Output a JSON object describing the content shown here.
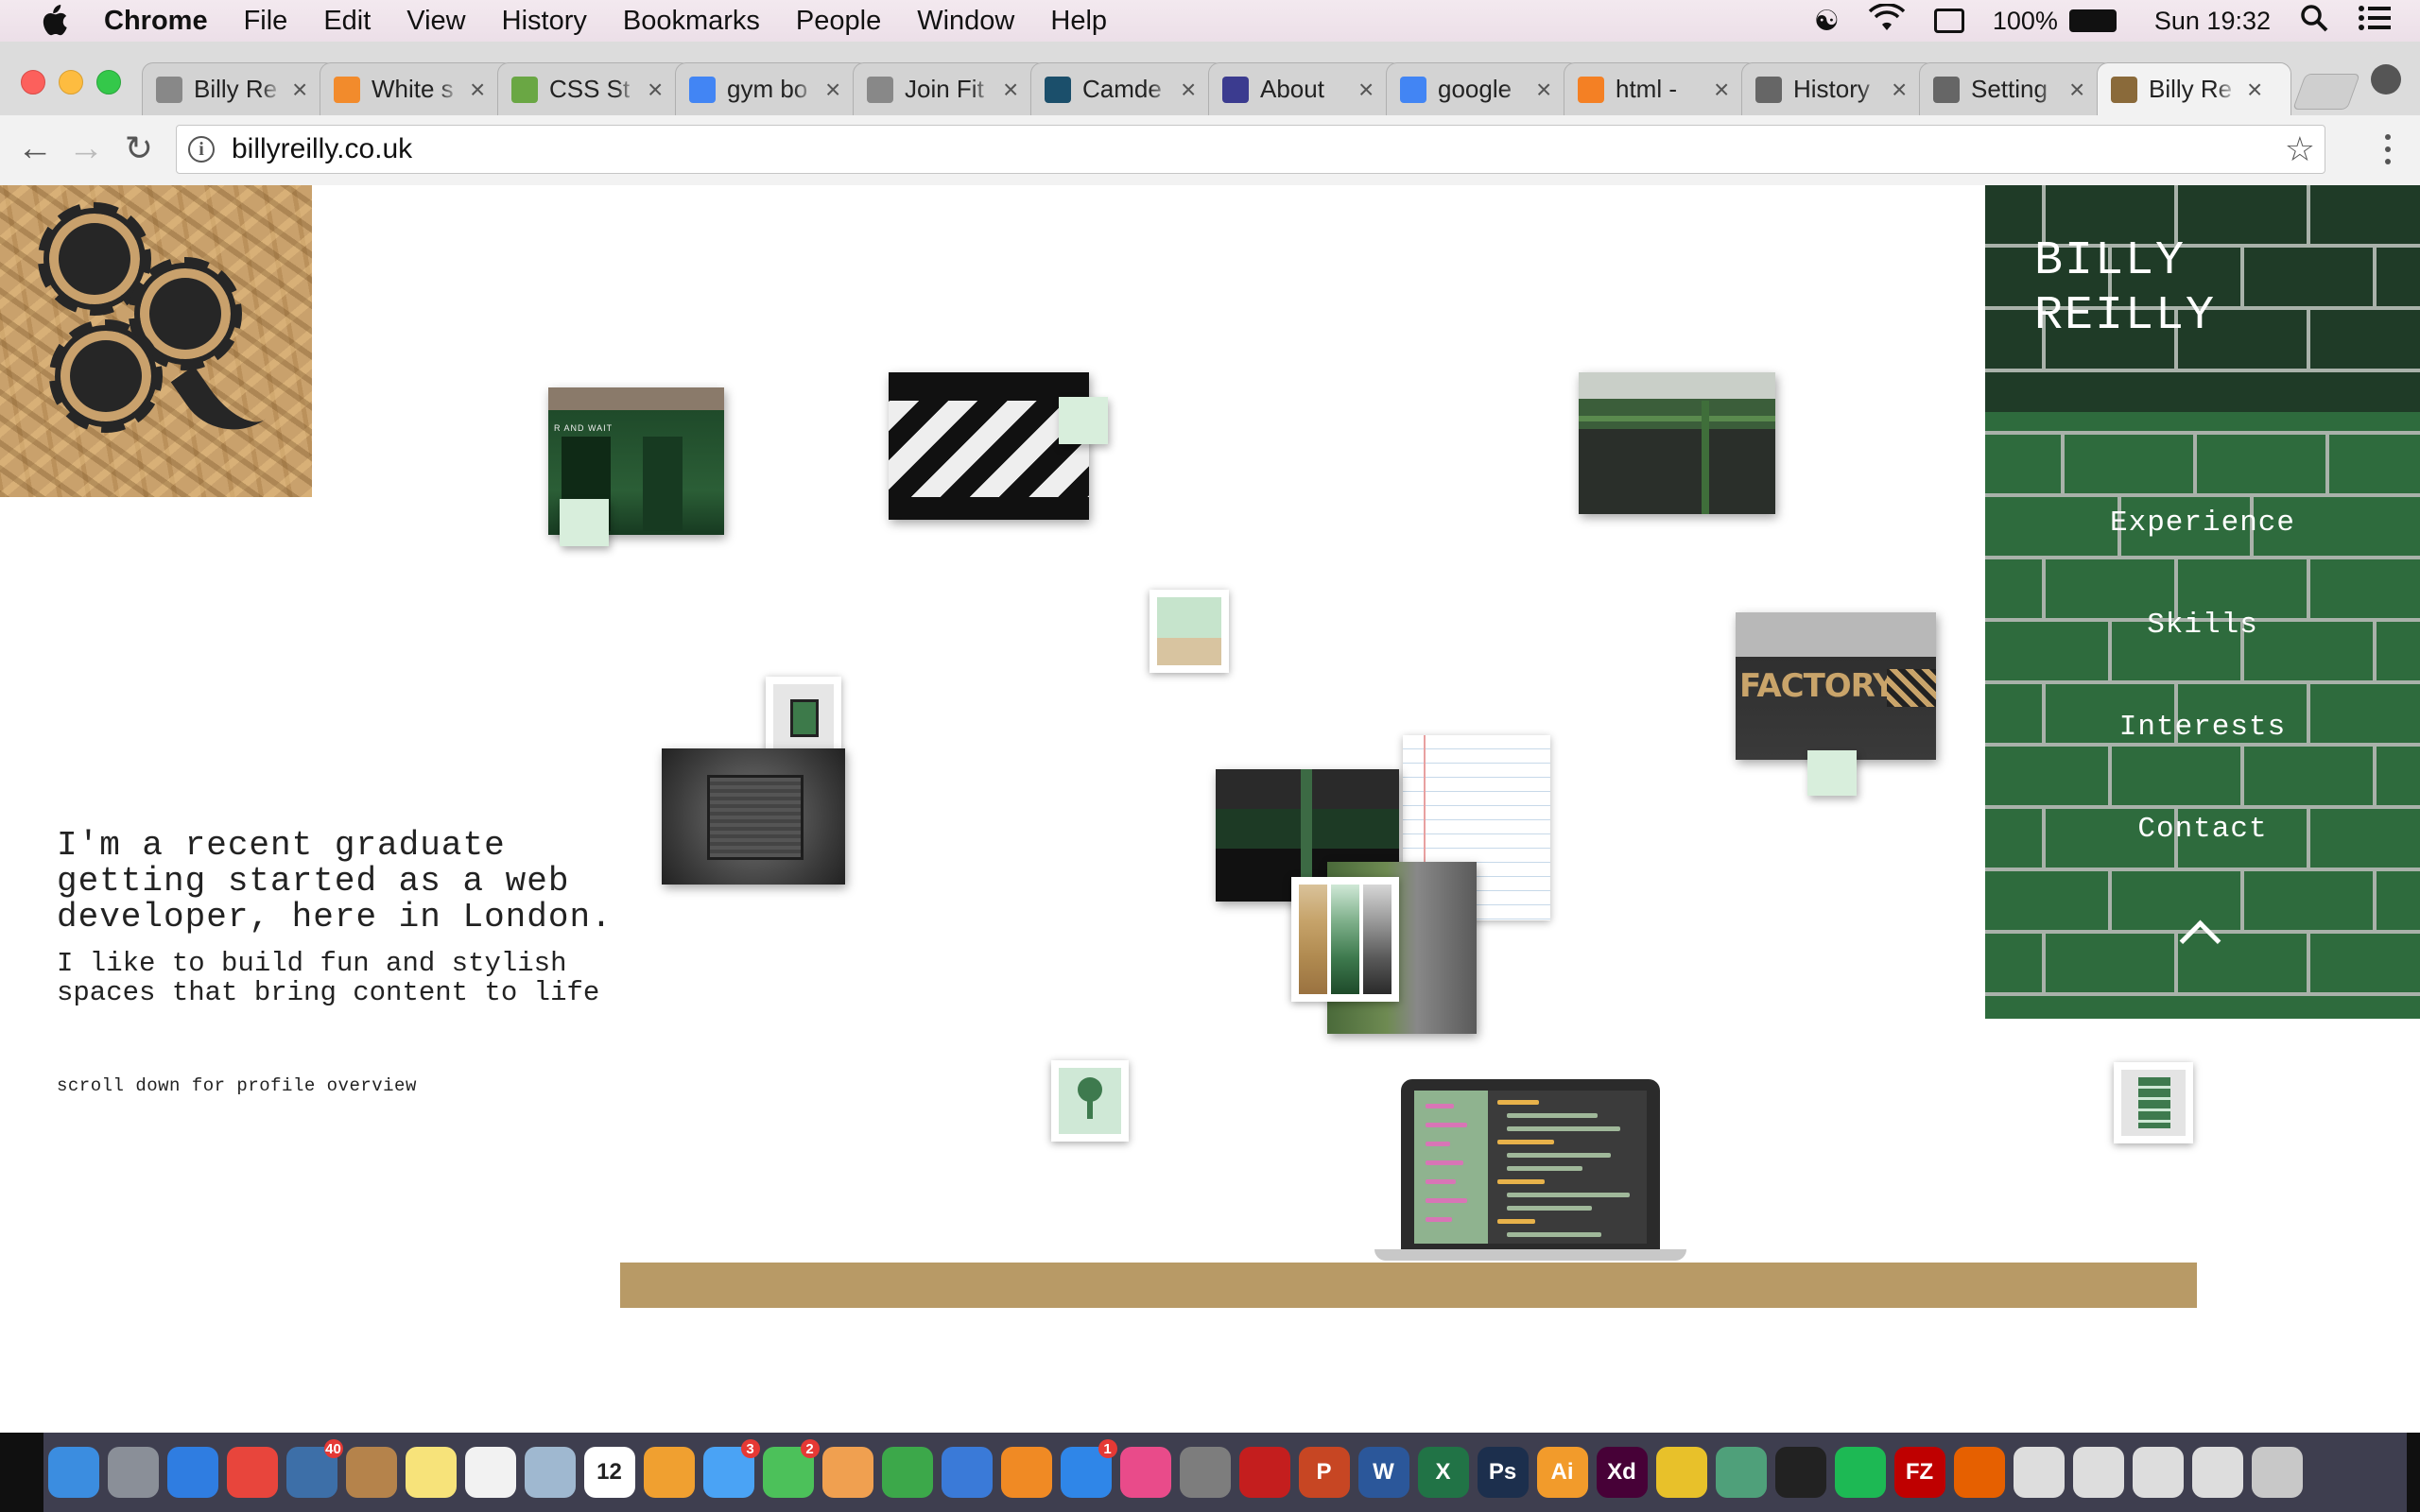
{
  "menubar": {
    "app": "Chrome",
    "items": [
      "File",
      "Edit",
      "View",
      "History",
      "Bookmarks",
      "People",
      "Window",
      "Help"
    ],
    "battery": "100%",
    "clock": "Sun 19:32"
  },
  "tabs": [
    {
      "title": "Billy Re",
      "icon": "page-icon",
      "color": "#888888"
    },
    {
      "title": "White s",
      "icon": "sitepoint-icon",
      "color": "#f28b2c"
    },
    {
      "title": "CSS St",
      "icon": "w3-icon",
      "color": "#6aa744"
    },
    {
      "title": "gym bo",
      "icon": "google-icon",
      "color": "#4285f4"
    },
    {
      "title": "Join Fit",
      "icon": "page-icon",
      "color": "#888888"
    },
    {
      "title": "Camde",
      "icon": "camden-icon",
      "color": "#1b4f6b"
    },
    {
      "title": "About",
      "icon": "fas-icon",
      "color": "#3b3b8f"
    },
    {
      "title": "google",
      "icon": "google-icon",
      "color": "#4285f4"
    },
    {
      "title": "html - ",
      "icon": "stackoverflow-icon",
      "color": "#f48024"
    },
    {
      "title": "History",
      "icon": "history-icon",
      "color": "#666666"
    },
    {
      "title": "Setting",
      "icon": "gear-icon",
      "color": "#666666"
    },
    {
      "title": "Billy Re",
      "icon": "logo-icon",
      "color": "#8a6a3a",
      "active": true
    }
  ],
  "address": {
    "url": "billyreilly.co.uk"
  },
  "site": {
    "brand": "BILLY\nREILLY",
    "nav": [
      "Experience",
      "Skills",
      "Interests",
      "Contact"
    ],
    "intro_heading": "I'm a recent graduate\ngetting started as a web\ndeveloper, here in London.",
    "intro_sub": "I like to build fun and stylish\nspaces that bring content to life",
    "scroll_hint": "scroll down for profile overview",
    "photo_texts": {
      "shopfront_sign": "R AND WAIT",
      "factory_sign": "FACTORY"
    },
    "colors": {
      "nav_green": "#2e6b3d",
      "desk": "#b89a66",
      "note": "#d8eedc"
    }
  },
  "dock": {
    "apps": [
      {
        "name": "finder",
        "label": "",
        "color": "#3b8de0"
      },
      {
        "name": "launchpad",
        "label": "",
        "color": "#8a8f98"
      },
      {
        "name": "safari",
        "label": "",
        "color": "#2f7de1"
      },
      {
        "name": "chrome",
        "label": "",
        "color": "#e8453c"
      },
      {
        "name": "mail-photo",
        "label": "",
        "color": "#3d6fa8",
        "badge": "40"
      },
      {
        "name": "contacts",
        "label": "",
        "color": "#b5834b"
      },
      {
        "name": "notes",
        "label": "",
        "color": "#f7e37a"
      },
      {
        "name": "reminders",
        "label": "",
        "color": "#f2f2f2"
      },
      {
        "name": "preview",
        "label": "",
        "color": "#9fb8d0"
      },
      {
        "name": "calendar",
        "label": "12",
        "color": "#ffffff"
      },
      {
        "name": "photos",
        "label": "",
        "color": "#f0a030"
      },
      {
        "name": "messages",
        "label": "",
        "color": "#4aa3f5",
        "badge": "3"
      },
      {
        "name": "facetime",
        "label": "",
        "color": "#4cc15a",
        "badge": "2"
      },
      {
        "name": "pages",
        "label": "",
        "color": "#f0a050"
      },
      {
        "name": "numbers",
        "label": "",
        "color": "#3ca84a"
      },
      {
        "name": "keynote",
        "label": "",
        "color": "#3a7ad8"
      },
      {
        "name": "ibooks",
        "label": "",
        "color": "#f08a24"
      },
      {
        "name": "appstore",
        "label": "",
        "color": "#2f86e8",
        "badge": "1"
      },
      {
        "name": "itunes",
        "label": "",
        "color": "#e94b8a"
      },
      {
        "name": "system-prefs",
        "label": "",
        "color": "#7d7d7d"
      },
      {
        "name": "acrobat",
        "label": "",
        "color": "#c41e1e"
      },
      {
        "name": "powerpoint",
        "label": "P",
        "color": "#c74623"
      },
      {
        "name": "word",
        "label": "W",
        "color": "#2b579a"
      },
      {
        "name": "excel",
        "label": "X",
        "color": "#217346"
      },
      {
        "name": "photoshop",
        "label": "Ps",
        "color": "#1c2f4d"
      },
      {
        "name": "illustrator",
        "label": "Ai",
        "color": "#f29b2b"
      },
      {
        "name": "xd",
        "label": "Xd",
        "color": "#470137"
      },
      {
        "name": "cyberduck",
        "label": "",
        "color": "#e8c12a"
      },
      {
        "name": "atom",
        "label": "",
        "color": "#4fa07a"
      },
      {
        "name": "terminal",
        "label": "",
        "color": "#222222"
      },
      {
        "name": "spotify",
        "label": "",
        "color": "#1db954"
      },
      {
        "name": "filezilla",
        "label": "FZ",
        "color": "#bf0000"
      },
      {
        "name": "firefox",
        "label": "",
        "color": "#e66000"
      },
      {
        "name": "documents-1",
        "label": "",
        "color": "#dddddd"
      },
      {
        "name": "documents-2",
        "label": "",
        "color": "#dddddd"
      },
      {
        "name": "documents-3",
        "label": "",
        "color": "#dddddd"
      },
      {
        "name": "documents-4",
        "label": "",
        "color": "#dddddd"
      },
      {
        "name": "trash",
        "label": "",
        "color": "#c8c8c8"
      }
    ]
  }
}
